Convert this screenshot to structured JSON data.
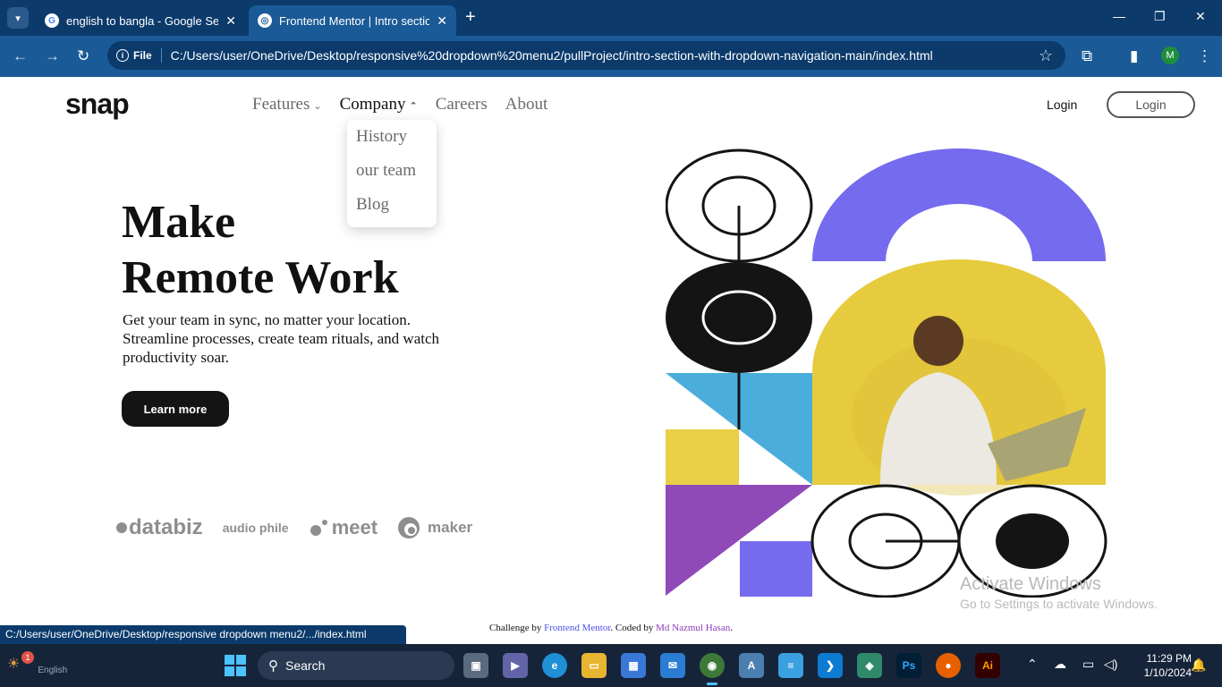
{
  "browser": {
    "tabs": [
      {
        "title": "english to bangla - Google Sear",
        "close": "✕"
      },
      {
        "title": "Frontend Mentor | Intro section",
        "close": "✕"
      }
    ],
    "new_tab": "+",
    "window_controls": [
      "—",
      "❐",
      "✕"
    ],
    "toolbar": {
      "back": "←",
      "forward": "→",
      "reload": "↻"
    },
    "address": {
      "chip_label": "File",
      "url": "C:/Users/user/OneDrive/Desktop/responsive%20dropdown%20menu2/pullProject/intro-section-with-dropdown-navigation-main/index.html"
    },
    "profile_initial": "M"
  },
  "site": {
    "logo": "snap",
    "nav": [
      {
        "label": "Features",
        "chevron": "⌄"
      },
      {
        "label": "Company",
        "chevron": "⌃"
      },
      {
        "label": "Careers"
      },
      {
        "label": "About"
      }
    ],
    "dropdown": [
      "History",
      "our team",
      "Blog"
    ],
    "login_link": "Login",
    "login_button": "Login",
    "hero": {
      "title_line1": "Make",
      "title_line2": "Remote Work",
      "description": "Get your team in sync, no matter your location. Streamline processes, create team rituals, and watch productivity soar.",
      "cta": "Learn more"
    },
    "clients": [
      "databiz",
      "audio phile",
      "meet",
      "maker"
    ],
    "footer": {
      "prefix": "Challenge by ",
      "mentor": "Frontend Mentor",
      "middle": ". Coded by ",
      "author": "Md Nazmul Hasan",
      "suffix": "."
    }
  },
  "watermark": {
    "line1": "Activate Windows",
    "line2": "Go to Settings to activate Windows."
  },
  "status_url": "C:/Users/user/OneDrive/Desktop/responsive dropdown menu2/.../index.html",
  "taskbar": {
    "weather_badge": "1",
    "language": "English",
    "search_label": "Search",
    "apps": [
      "Ps",
      "Ai"
    ],
    "time": "11:29 PM",
    "date": "1/10/2024"
  },
  "colors": {
    "accent_purple": "#746bef",
    "accent_yellow": "#e8cf45",
    "accent_blue": "#4aaddc",
    "accent_violet": "#8f4ab8"
  }
}
